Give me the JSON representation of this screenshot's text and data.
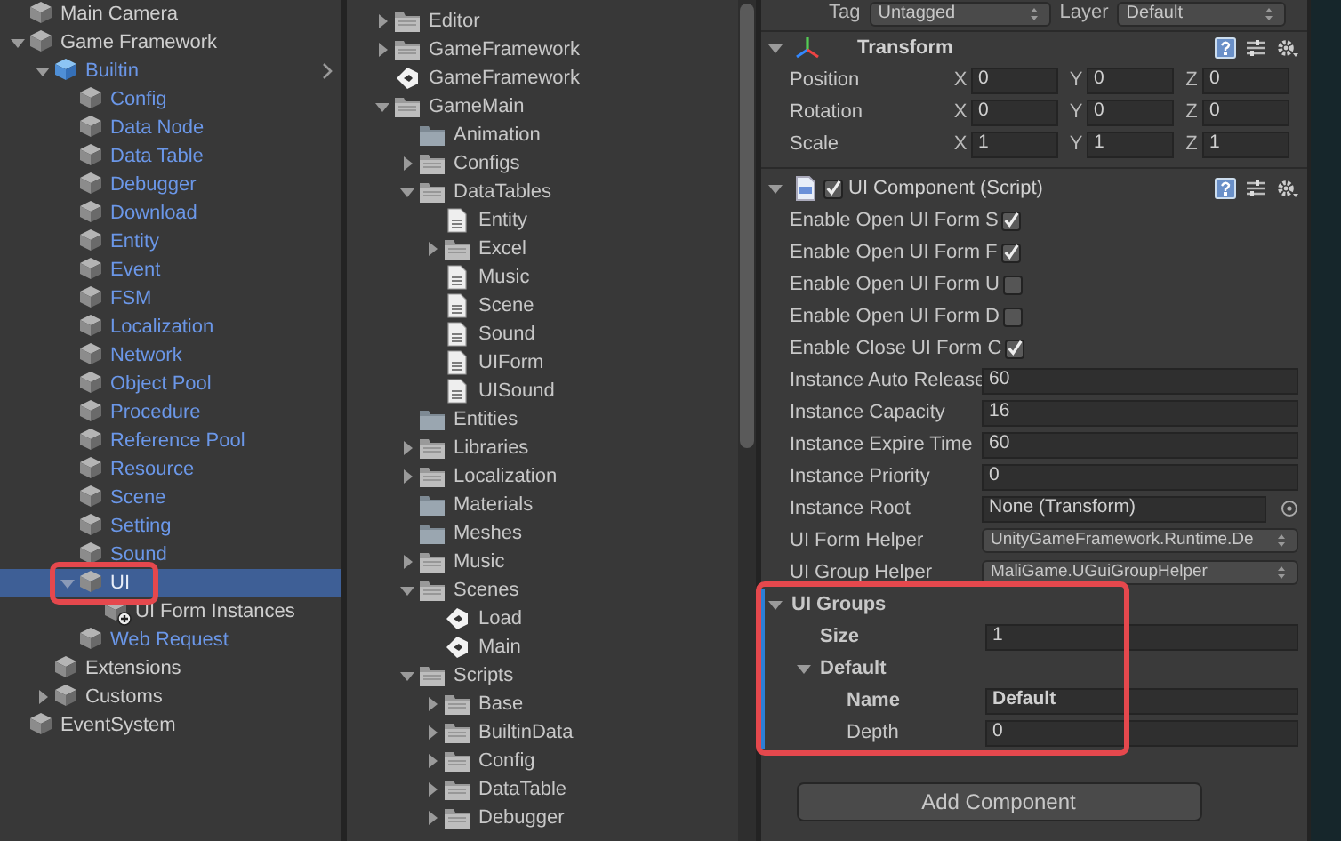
{
  "hierarchy": {
    "items": [
      {
        "label": "Main Camera",
        "kind": "object",
        "selected": false
      },
      {
        "label": "Game Framework",
        "kind": "object",
        "expanded": true,
        "selected": false,
        "children": [
          {
            "label": "Builtin",
            "kind": "prefab-root",
            "expanded": true,
            "selected": false,
            "children": [
              {
                "label": "Config",
                "kind": "prefab",
                "selected": false
              },
              {
                "label": "Data Node",
                "kind": "prefab",
                "selected": false
              },
              {
                "label": "Data Table",
                "kind": "prefab",
                "selected": false
              },
              {
                "label": "Debugger",
                "kind": "prefab",
                "selected": false
              },
              {
                "label": "Download",
                "kind": "prefab",
                "selected": false
              },
              {
                "label": "Entity",
                "kind": "prefab",
                "selected": false
              },
              {
                "label": "Event",
                "kind": "prefab",
                "selected": false
              },
              {
                "label": "FSM",
                "kind": "prefab",
                "selected": false
              },
              {
                "label": "Localization",
                "kind": "prefab",
                "selected": false
              },
              {
                "label": "Network",
                "kind": "prefab",
                "selected": false
              },
              {
                "label": "Object Pool",
                "kind": "prefab",
                "selected": false
              },
              {
                "label": "Procedure",
                "kind": "prefab",
                "selected": false
              },
              {
                "label": "Reference Pool",
                "kind": "prefab",
                "selected": false
              },
              {
                "label": "Resource",
                "kind": "prefab",
                "selected": false
              },
              {
                "label": "Scene",
                "kind": "prefab",
                "selected": false
              },
              {
                "label": "Setting",
                "kind": "prefab",
                "selected": false
              },
              {
                "label": "Sound",
                "kind": "prefab",
                "selected": false
              },
              {
                "label": "UI",
                "kind": "prefab",
                "expanded": true,
                "selected": true,
                "highlighted": true,
                "children": [
                  {
                    "label": "UI Form Instances",
                    "kind": "added-object",
                    "selected": false
                  }
                ]
              },
              {
                "label": "Web Request",
                "kind": "prefab",
                "selected": false
              }
            ]
          },
          {
            "label": "Extensions",
            "kind": "object",
            "selected": false
          },
          {
            "label": "Customs",
            "kind": "object",
            "expanded": false,
            "selected": false
          }
        ]
      },
      {
        "label": "EventSystem",
        "kind": "object",
        "selected": false
      }
    ]
  },
  "project": {
    "items": [
      {
        "label": "Editor",
        "kind": "folder",
        "expanded": false
      },
      {
        "label": "GameFramework",
        "kind": "folder",
        "expanded": false
      },
      {
        "label": "GameFramework",
        "kind": "scene"
      },
      {
        "label": "GameMain",
        "kind": "folder",
        "expanded": true,
        "children": [
          {
            "label": "Animation",
            "kind": "empty-folder"
          },
          {
            "label": "Configs",
            "kind": "folder",
            "expanded": false
          },
          {
            "label": "DataTables",
            "kind": "folder",
            "expanded": true,
            "children": [
              {
                "label": "Entity",
                "kind": "file"
              },
              {
                "label": "Excel",
                "kind": "folder",
                "expanded": false
              },
              {
                "label": "Music",
                "kind": "file"
              },
              {
                "label": "Scene",
                "kind": "file"
              },
              {
                "label": "Sound",
                "kind": "file"
              },
              {
                "label": "UIForm",
                "kind": "file"
              },
              {
                "label": "UISound",
                "kind": "file"
              }
            ]
          },
          {
            "label": "Entities",
            "kind": "empty-folder"
          },
          {
            "label": "Libraries",
            "kind": "folder",
            "expanded": false
          },
          {
            "label": "Localization",
            "kind": "folder",
            "expanded": false
          },
          {
            "label": "Materials",
            "kind": "empty-folder"
          },
          {
            "label": "Meshes",
            "kind": "empty-folder"
          },
          {
            "label": "Music",
            "kind": "folder",
            "expanded": false
          },
          {
            "label": "Scenes",
            "kind": "folder",
            "expanded": true,
            "children": [
              {
                "label": "Load",
                "kind": "scene"
              },
              {
                "label": "Main",
                "kind": "scene"
              }
            ]
          },
          {
            "label": "Scripts",
            "kind": "folder",
            "expanded": true,
            "children": [
              {
                "label": "Base",
                "kind": "folder",
                "expanded": false
              },
              {
                "label": "BuiltinData",
                "kind": "folder",
                "expanded": false
              },
              {
                "label": "Config",
                "kind": "folder",
                "expanded": false
              },
              {
                "label": "DataTable",
                "kind": "folder",
                "expanded": false
              },
              {
                "label": "Debugger",
                "kind": "folder",
                "expanded": false
              }
            ]
          }
        ]
      }
    ]
  },
  "inspector": {
    "tag_label": "Tag",
    "tag_value": "Untagged",
    "layer_label": "Layer",
    "layer_value": "Default",
    "components": [
      {
        "kind": "transform",
        "title": "Transform",
        "expanded": true,
        "rows": [
          {
            "label": "Position",
            "axes": [
              {
                "axis": "X",
                "value": "0"
              },
              {
                "axis": "Y",
                "value": "0"
              },
              {
                "axis": "Z",
                "value": "0"
              }
            ]
          },
          {
            "label": "Rotation",
            "axes": [
              {
                "axis": "X",
                "value": "0"
              },
              {
                "axis": "Y",
                "value": "0"
              },
              {
                "axis": "Z",
                "value": "0"
              }
            ]
          },
          {
            "label": "Scale",
            "axes": [
              {
                "axis": "X",
                "value": "1"
              },
              {
                "axis": "Y",
                "value": "1"
              },
              {
                "axis": "Z",
                "value": "1"
              }
            ]
          }
        ]
      },
      {
        "kind": "script",
        "title": "UI Component (Script)",
        "expanded": true,
        "enabled": true,
        "properties": [
          {
            "kind": "checkbox",
            "label": "Enable Open UI Form S",
            "checked": true
          },
          {
            "kind": "checkbox",
            "label": "Enable Open UI Form F",
            "checked": true
          },
          {
            "kind": "checkbox",
            "label": "Enable Open UI Form U",
            "checked": false
          },
          {
            "kind": "checkbox",
            "label": "Enable Open UI Form D",
            "checked": false
          },
          {
            "kind": "checkbox",
            "label": "Enable Close UI Form C",
            "checked": true
          },
          {
            "kind": "text",
            "label": "Instance Auto Release",
            "value": "60"
          },
          {
            "kind": "text",
            "label": "Instance Capacity",
            "value": "16"
          },
          {
            "kind": "text",
            "label": "Instance Expire Time",
            "value": "60"
          },
          {
            "kind": "text",
            "label": "Instance Priority",
            "value": "0"
          },
          {
            "kind": "object",
            "label": "Instance Root",
            "value": "None (Transform)"
          },
          {
            "kind": "dropdown",
            "label": "UI Form Helper",
            "value": "UnityGameFramework.Runtime.De"
          },
          {
            "kind": "dropdown",
            "label": "UI Group Helper",
            "value": "MaliGame.UGuiGroupHelper"
          },
          {
            "kind": "foldout",
            "label": "UI Groups",
            "expanded": true,
            "overridden": true,
            "highlighted": true,
            "children": [
              {
                "kind": "text",
                "label": "Size",
                "value": "1",
                "overridden": true
              },
              {
                "kind": "foldout",
                "label": "Default",
                "expanded": true,
                "overridden": true,
                "children": [
                  {
                    "kind": "text",
                    "label": "Name",
                    "value": "Default",
                    "overridden": true
                  },
                  {
                    "kind": "text",
                    "label": "Depth",
                    "value": "0",
                    "overridden": false
                  }
                ]
              }
            ]
          }
        ]
      }
    ],
    "add_button": "Add Component"
  }
}
